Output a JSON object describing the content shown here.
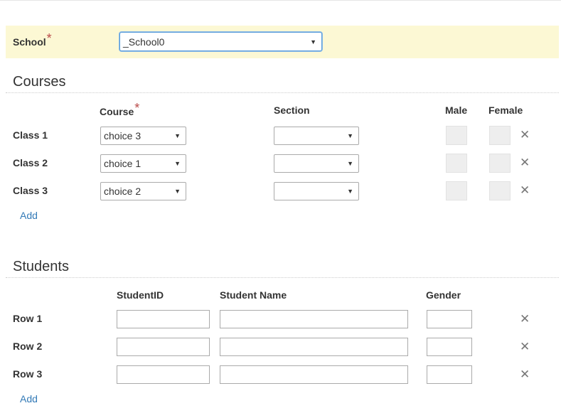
{
  "school": {
    "label": "School",
    "required_mark": "*",
    "selected": "_School0"
  },
  "courses": {
    "title": "Courses",
    "headers": {
      "course": "Course",
      "course_required": "*",
      "section": "Section",
      "male": "Male",
      "female": "Female"
    },
    "rows": [
      {
        "label": "Class 1",
        "course": "choice 3",
        "section": ""
      },
      {
        "label": "Class 2",
        "course": "choice 1",
        "section": ""
      },
      {
        "label": "Class 3",
        "course": "choice 2",
        "section": ""
      }
    ],
    "add_label": "Add"
  },
  "students": {
    "title": "Students",
    "headers": {
      "student_id": "StudentID",
      "student_name": "Student Name",
      "gender": "Gender"
    },
    "rows": [
      {
        "label": "Row 1",
        "student_id": "",
        "student_name": "",
        "gender": ""
      },
      {
        "label": "Row 2",
        "student_id": "",
        "student_name": "",
        "gender": ""
      },
      {
        "label": "Row 3",
        "student_id": "",
        "student_name": "",
        "gender": ""
      }
    ],
    "add_label": "Add"
  },
  "icons": {
    "remove": "close-icon",
    "dropdown": "caret-down-icon"
  },
  "colors": {
    "highlight_bar": "#fcf8d4",
    "required": "#b94a48",
    "link": "#337ab7",
    "focus_border": "#5b9dd9"
  },
  "glyphs": {
    "caret": "▼",
    "remove": "✕"
  }
}
